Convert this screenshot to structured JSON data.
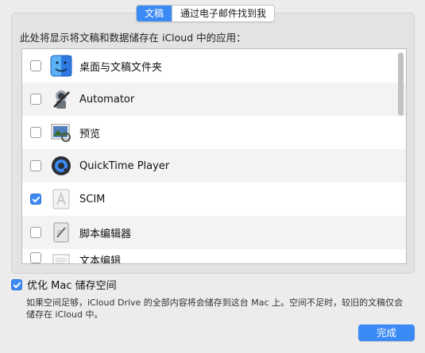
{
  "tabs": [
    {
      "label": "文稿",
      "active": true
    },
    {
      "label": "通过电子邮件找到我",
      "active": false
    }
  ],
  "description": "此处将显示将文稿和数据储存在 iCloud 中的应用：",
  "apps": [
    {
      "name": "桌面与文稿文件夹",
      "checked": false,
      "icon": "finder-icon"
    },
    {
      "name": "Automator",
      "checked": false,
      "icon": "automator-icon"
    },
    {
      "name": "预览",
      "checked": false,
      "icon": "preview-icon"
    },
    {
      "name": "QuickTime Player",
      "checked": false,
      "icon": "quicktime-icon"
    },
    {
      "name": "SCIM",
      "checked": true,
      "icon": "scim-icon"
    },
    {
      "name": "脚本编辑器",
      "checked": false,
      "icon": "script-editor-icon"
    },
    {
      "name": "文本编辑",
      "checked": false,
      "icon": "textedit-icon"
    }
  ],
  "optimize": {
    "label": "优化 Mac 储存空间",
    "checked": true
  },
  "note": "如果空间足够，iCloud Drive 的全部内容将会储存到这台 Mac 上。空间不足时，较旧的文稿仅会储存在 iCloud 中。",
  "done_label": "完成",
  "colors": {
    "accent": "#3b8af5",
    "background": "#ececec"
  }
}
